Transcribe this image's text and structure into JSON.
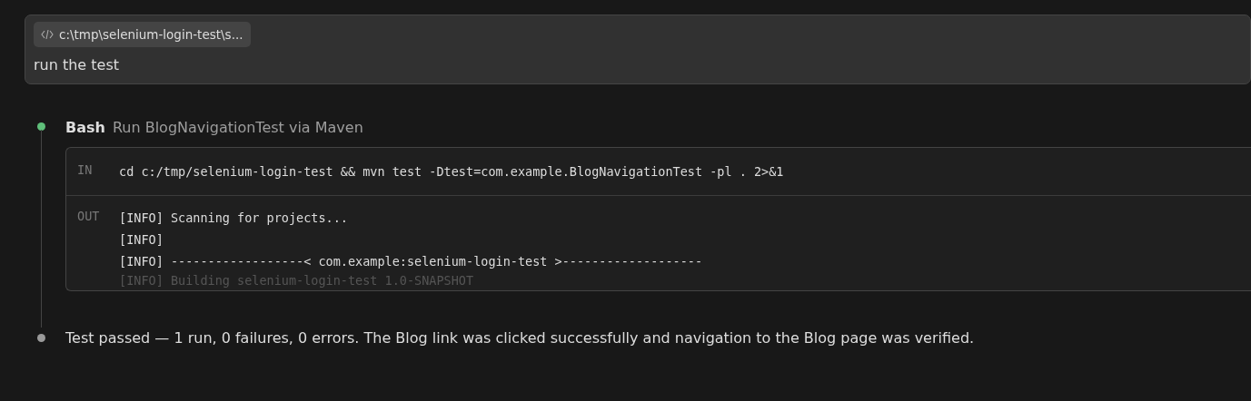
{
  "prompt": {
    "context_chip": {
      "label": "c:\\tmp\\selenium-login-test\\s..."
    },
    "text": "run the test"
  },
  "steps": [
    {
      "kind": "tool",
      "color": "#5fbf7a",
      "tool": "Bash",
      "description": "Run BlogNavigationTest via Maven",
      "input_label": "IN",
      "input": "cd c:/tmp/selenium-login-test && mvn test -Dtest=com.example.BlogNavigationTest -pl . 2>&1",
      "output_label": "OUT",
      "output_lines": [
        "[INFO] Scanning for projects...",
        "[INFO]",
        "[INFO] ------------------< com.example:selenium-login-test >-------------------",
        "[INFO] Building selenium-login-test 1.0-SNAPSHOT"
      ]
    },
    {
      "kind": "message",
      "color": "#9a9a9a",
      "text": "Test passed — 1 run, 0 failures, 0 errors. The Blog link was clicked successfully and navigation to the Blog page was verified."
    }
  ]
}
